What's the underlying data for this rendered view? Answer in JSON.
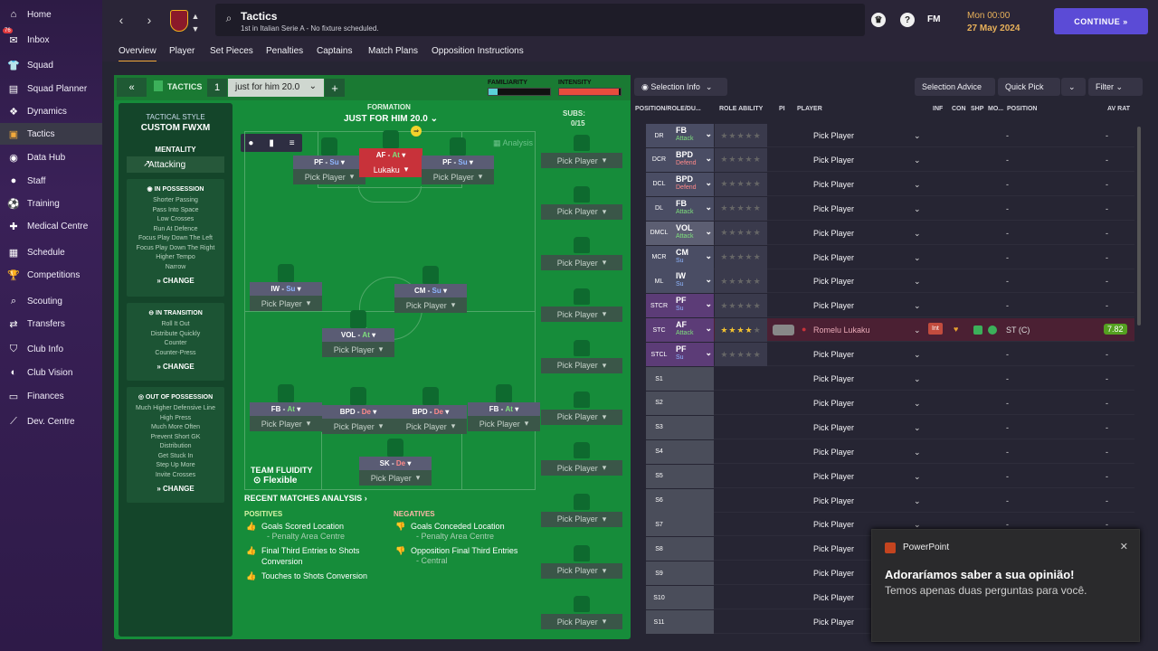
{
  "sidebar": {
    "inbox_badge": "76",
    "items": [
      {
        "label": "Home",
        "icon": "home-icon",
        "glyph": "⌂"
      },
      {
        "label": "Inbox",
        "icon": "inbox-icon",
        "glyph": "✉"
      },
      {
        "label": "Squad",
        "icon": "squad-icon",
        "glyph": "👕"
      },
      {
        "label": "Squad Planner",
        "icon": "clipboard-icon",
        "glyph": "▤"
      },
      {
        "label": "Dynamics",
        "icon": "dynamics-icon",
        "glyph": "❖"
      },
      {
        "label": "Tactics",
        "icon": "tactics-icon",
        "glyph": "▣"
      },
      {
        "label": "Data Hub",
        "icon": "data-hub-icon",
        "glyph": "◉"
      },
      {
        "label": "Staff",
        "icon": "staff-icon",
        "glyph": "●"
      },
      {
        "label": "Training",
        "icon": "training-icon",
        "glyph": "⚽"
      },
      {
        "label": "Medical Centre",
        "icon": "medical-icon",
        "glyph": "✚"
      },
      {
        "label": "Schedule",
        "icon": "calendar-icon",
        "glyph": "▦"
      },
      {
        "label": "Competitions",
        "icon": "trophy-icon",
        "glyph": "🏆"
      },
      {
        "label": "Scouting",
        "icon": "search-icon",
        "glyph": "⌕"
      },
      {
        "label": "Transfers",
        "icon": "transfers-icon",
        "glyph": "⇄"
      },
      {
        "label": "Club Info",
        "icon": "shield-icon",
        "glyph": "⛉"
      },
      {
        "label": "Club Vision",
        "icon": "vision-icon",
        "glyph": "◐"
      },
      {
        "label": "Finances",
        "icon": "finances-icon",
        "glyph": "▭"
      },
      {
        "label": "Dev. Centre",
        "icon": "dev-centre-icon",
        "glyph": "⟋"
      }
    ]
  },
  "header": {
    "title": "Tactics",
    "subtitle": "1st in Italian Serie A - No fixture scheduled.",
    "fm": "FM",
    "time": "Mon 00:00",
    "date": "27 May 2024",
    "continue": "CONTINUE"
  },
  "tabs": [
    "Overview",
    "Player",
    "Set Pieces",
    "Penalties",
    "Captains",
    "Match Plans",
    "Opposition Instructions"
  ],
  "tactic": {
    "back": "«",
    "label": "TACTICS",
    "number": "1",
    "name": "just for him 20.0",
    "plus": "+",
    "familiarity": "FAMILIARITY",
    "intensity": "INTENSITY",
    "style_label": "TACTICAL STYLE",
    "style_value": "CUSTOM FWXM",
    "mentality_label": "MENTALITY",
    "mentality": "Attacking",
    "formation_label": "FORMATION",
    "formation": "JUST FOR HIM 20.0",
    "subs_label": "SUBS:",
    "subs_count": "0/15",
    "analysis_btn": "Analysis",
    "fluidity_label": "TEAM FLUIDITY",
    "fluidity": "Flexible",
    "change": "CHANGE"
  },
  "in_possession": {
    "title": "IN POSSESSION",
    "lines": [
      "Shorter Passing",
      "Pass Into Space",
      "Low Crosses",
      "Run At Defence",
      "Focus Play Down The Left",
      "Focus Play Down The Right",
      "Higher Tempo",
      "Narrow"
    ]
  },
  "in_transition": {
    "title": "IN TRANSITION",
    "lines": [
      "Roll It Out",
      "Distribute Quickly",
      "Counter",
      "Counter-Press"
    ]
  },
  "out_possession": {
    "title": "OUT OF POSSESSION",
    "lines": [
      "Much Higher Defensive Line",
      "High Press",
      "Much More Often",
      "Prevent Short GK",
      "Distribution",
      "Get Stuck In",
      "Step Up More",
      "Invite Crosses"
    ]
  },
  "pitch_players": [
    {
      "role": "PF",
      "duty": "Su",
      "name": "Pick Player"
    },
    {
      "role": "AF",
      "duty": "At",
      "name": "Lukaku"
    },
    {
      "role": "PF",
      "duty": "Su",
      "name": "Pick Player"
    },
    {
      "role": "IW",
      "duty": "Su",
      "name": "Pick Player"
    },
    {
      "role": "CM",
      "duty": "Su",
      "name": "Pick Player"
    },
    {
      "role": "VOL",
      "duty": "At",
      "name": "Pick Player"
    },
    {
      "role": "FB",
      "duty": "At",
      "name": "Pick Player"
    },
    {
      "role": "BPD",
      "duty": "De",
      "name": "Pick Player"
    },
    {
      "role": "BPD",
      "duty": "De",
      "name": "Pick Player"
    },
    {
      "role": "FB",
      "duty": "At",
      "name": "Pick Player"
    },
    {
      "role": "SK",
      "duty": "De",
      "name": "Pick Player"
    }
  ],
  "subs": [
    "Pick Player",
    "Pick Player",
    "Pick Player",
    "Pick Player",
    "Pick Player",
    "Pick Player",
    "Pick Player",
    "Pick Player",
    "Pick Player",
    "Pick Player"
  ],
  "analysis": {
    "title": "RECENT MATCHES ANALYSIS",
    "positives_label": "POSITIVES",
    "negatives_label": "NEGATIVES",
    "positives": [
      {
        "text": "Goals Scored Location",
        "sub": "- Penalty Area Centre"
      },
      {
        "text": "Final Third Entries to Shots Conversion",
        "sub": ""
      },
      {
        "text": "Touches to Shots Conversion",
        "sub": ""
      }
    ],
    "negatives": [
      {
        "text": "Goals Conceded Location",
        "sub": "- Penalty Area Centre"
      },
      {
        "text": "Opposition Final Third Entries",
        "sub": "- Central"
      }
    ]
  },
  "right": {
    "selection_info": "Selection Info",
    "selection_advice": "Selection Advice",
    "quick_pick": "Quick Pick",
    "filter": "Filter",
    "columns": [
      "POSITION/ROLE/DU...",
      "ROLE ABILITY",
      "PI",
      "PLAYER",
      "INF",
      "CON",
      "SHP",
      "MO...",
      "POSITION",
      "AV RAT"
    ]
  },
  "rows": [
    {
      "pos": "DR",
      "role": "FB",
      "duty": "Attack",
      "player": "Pick Player",
      "position": "-",
      "avr": "-"
    },
    {
      "pos": "DCR",
      "role": "BPD",
      "duty": "Defend",
      "player": "Pick Player",
      "position": "-",
      "avr": "-"
    },
    {
      "pos": "DCL",
      "role": "BPD",
      "duty": "Defend",
      "player": "Pick Player",
      "position": "-",
      "avr": "-"
    },
    {
      "pos": "DL",
      "role": "FB",
      "duty": "Attack",
      "player": "Pick Player",
      "position": "-",
      "avr": "-"
    },
    {
      "pos": "DMCL",
      "role": "VOL",
      "duty": "Attack",
      "player": "Pick Player",
      "position": "-",
      "avr": "-"
    },
    {
      "pos": "MCR",
      "role": "CM",
      "duty": "Su",
      "player": "Pick Player",
      "position": "-",
      "avr": "-"
    },
    {
      "pos": "ML",
      "role": "IW",
      "duty": "Su",
      "player": "Pick Player",
      "position": "-",
      "avr": "-"
    },
    {
      "pos": "STCR",
      "role": "PF",
      "duty": "Su",
      "player": "Pick Player",
      "position": "-",
      "avr": "-"
    },
    {
      "pos": "STC",
      "role": "AF",
      "duty": "Attack",
      "player": "Romelu Lukaku",
      "position": "ST (C)",
      "avr": "7.82"
    },
    {
      "pos": "STCL",
      "role": "PF",
      "duty": "Su",
      "player": "Pick Player",
      "position": "-",
      "avr": "-"
    },
    {
      "pos": "S1",
      "role": "",
      "duty": "",
      "player": "Pick Player",
      "position": "-",
      "avr": "-"
    },
    {
      "pos": "S2",
      "role": "",
      "duty": "",
      "player": "Pick Player",
      "position": "-",
      "avr": "-"
    },
    {
      "pos": "S3",
      "role": "",
      "duty": "",
      "player": "Pick Player",
      "position": "-",
      "avr": "-"
    },
    {
      "pos": "S4",
      "role": "",
      "duty": "",
      "player": "Pick Player",
      "position": "-",
      "avr": "-"
    },
    {
      "pos": "S5",
      "role": "",
      "duty": "",
      "player": "Pick Player",
      "position": "-",
      "avr": "-"
    },
    {
      "pos": "S6",
      "role": "",
      "duty": "",
      "player": "Pick Player",
      "position": "-",
      "avr": "-"
    },
    {
      "pos": "S7",
      "role": "",
      "duty": "",
      "player": "Pick Player",
      "position": "-",
      "avr": "-"
    },
    {
      "pos": "S8",
      "role": "",
      "duty": "",
      "player": "Pick Player",
      "position": "-",
      "avr": "-"
    },
    {
      "pos": "S9",
      "role": "",
      "duty": "",
      "player": "Pick Player",
      "position": "-",
      "avr": "-"
    },
    {
      "pos": "S10",
      "role": "",
      "duty": "",
      "player": "Pick Player",
      "position": "-",
      "avr": "-"
    },
    {
      "pos": "S11",
      "role": "",
      "duty": "",
      "player": "Pick Player",
      "position": "-",
      "avr": "-"
    }
  ],
  "lukaku_badges": {
    "int": "Int"
  },
  "toast": {
    "app": "PowerPoint",
    "title": "Adoraríamos saber a sua opinião!",
    "body": "Temos apenas duas perguntas para você.",
    "close": "✕"
  },
  "colors": {
    "accent": "#f2a93b",
    "continue": "#5b4bd6",
    "pitch": "#168c3a"
  }
}
